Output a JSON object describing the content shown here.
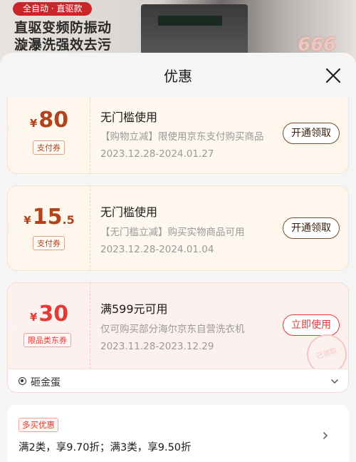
{
  "banner": {
    "badge": "全自动 · 直驱款",
    "line1": "直驱变频防振动",
    "line2": "漩瀑洗强效去污",
    "number": "666"
  },
  "sheet": {
    "title": "优惠"
  },
  "coupons": [
    {
      "currency": "¥",
      "amount": "80",
      "amount_decimal": "",
      "tag": "支付券",
      "title": "无门槛使用",
      "desc": "【购物立减】限使用京东支付购买商品",
      "date": "2023.12.28-2024.01.27",
      "button": "开通领取"
    },
    {
      "currency": "¥",
      "amount": "15",
      "amount_decimal": ".5",
      "tag": "支付券",
      "title": "无门槛使用",
      "desc": "【无门槛立减】购买实物商品可用",
      "date": "2023.12.28-2024.01.04",
      "button": "开通领取"
    },
    {
      "currency": "¥",
      "amount": "30",
      "amount_decimal": "",
      "tag": "限品类东券",
      "title": "满599元可用",
      "desc": "仅可购买部分海尔京东自营洗衣机",
      "date": "2023.11.28-2023.12.29",
      "button": "立即使用",
      "stamp": "已领取",
      "extra_label": "砸金蛋"
    }
  ],
  "multibuy": {
    "tag": "多买优惠",
    "text": "满2类，享9.70折；满3类，享9.50折"
  },
  "colors": {
    "gold_accent": "#b3431c",
    "red_accent": "#e33a33",
    "banner_badge": "#c8262b"
  }
}
